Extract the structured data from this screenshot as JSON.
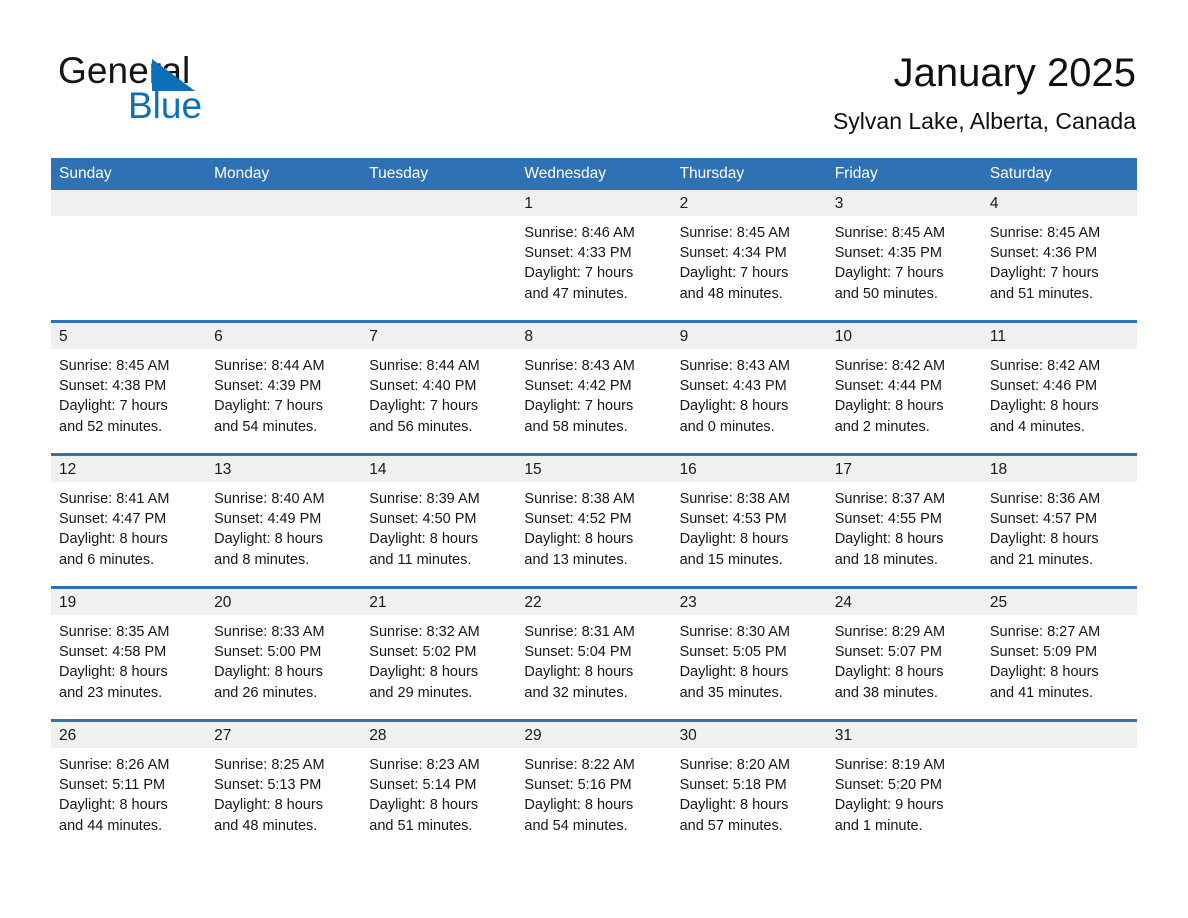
{
  "brand": {
    "name_part1": "General",
    "name_part2": "Blue",
    "triangle_color": "#0d6fb8"
  },
  "header": {
    "title": "January 2025",
    "subtitle": "Sylvan Lake, Alberta, Canada"
  },
  "theme": {
    "accent": "#2e71b5",
    "day_band": "#f0f0f0",
    "text": "#161616"
  },
  "calendar": {
    "weekday_headers": [
      "Sunday",
      "Monday",
      "Tuesday",
      "Wednesday",
      "Thursday",
      "Friday",
      "Saturday"
    ],
    "weeks": [
      [
        {
          "day": "",
          "sunrise": "",
          "sunset": "",
          "daylight_line1": "",
          "daylight_line2": ""
        },
        {
          "day": "",
          "sunrise": "",
          "sunset": "",
          "daylight_line1": "",
          "daylight_line2": ""
        },
        {
          "day": "",
          "sunrise": "",
          "sunset": "",
          "daylight_line1": "",
          "daylight_line2": ""
        },
        {
          "day": "1",
          "sunrise": "Sunrise: 8:46 AM",
          "sunset": "Sunset: 4:33 PM",
          "daylight_line1": "Daylight: 7 hours",
          "daylight_line2": "and 47 minutes."
        },
        {
          "day": "2",
          "sunrise": "Sunrise: 8:45 AM",
          "sunset": "Sunset: 4:34 PM",
          "daylight_line1": "Daylight: 7 hours",
          "daylight_line2": "and 48 minutes."
        },
        {
          "day": "3",
          "sunrise": "Sunrise: 8:45 AM",
          "sunset": "Sunset: 4:35 PM",
          "daylight_line1": "Daylight: 7 hours",
          "daylight_line2": "and 50 minutes."
        },
        {
          "day": "4",
          "sunrise": "Sunrise: 8:45 AM",
          "sunset": "Sunset: 4:36 PM",
          "daylight_line1": "Daylight: 7 hours",
          "daylight_line2": "and 51 minutes."
        }
      ],
      [
        {
          "day": "5",
          "sunrise": "Sunrise: 8:45 AM",
          "sunset": "Sunset: 4:38 PM",
          "daylight_line1": "Daylight: 7 hours",
          "daylight_line2": "and 52 minutes."
        },
        {
          "day": "6",
          "sunrise": "Sunrise: 8:44 AM",
          "sunset": "Sunset: 4:39 PM",
          "daylight_line1": "Daylight: 7 hours",
          "daylight_line2": "and 54 minutes."
        },
        {
          "day": "7",
          "sunrise": "Sunrise: 8:44 AM",
          "sunset": "Sunset: 4:40 PM",
          "daylight_line1": "Daylight: 7 hours",
          "daylight_line2": "and 56 minutes."
        },
        {
          "day": "8",
          "sunrise": "Sunrise: 8:43 AM",
          "sunset": "Sunset: 4:42 PM",
          "daylight_line1": "Daylight: 7 hours",
          "daylight_line2": "and 58 minutes."
        },
        {
          "day": "9",
          "sunrise": "Sunrise: 8:43 AM",
          "sunset": "Sunset: 4:43 PM",
          "daylight_line1": "Daylight: 8 hours",
          "daylight_line2": "and 0 minutes."
        },
        {
          "day": "10",
          "sunrise": "Sunrise: 8:42 AM",
          "sunset": "Sunset: 4:44 PM",
          "daylight_line1": "Daylight: 8 hours",
          "daylight_line2": "and 2 minutes."
        },
        {
          "day": "11",
          "sunrise": "Sunrise: 8:42 AM",
          "sunset": "Sunset: 4:46 PM",
          "daylight_line1": "Daylight: 8 hours",
          "daylight_line2": "and 4 minutes."
        }
      ],
      [
        {
          "day": "12",
          "sunrise": "Sunrise: 8:41 AM",
          "sunset": "Sunset: 4:47 PM",
          "daylight_line1": "Daylight: 8 hours",
          "daylight_line2": "and 6 minutes."
        },
        {
          "day": "13",
          "sunrise": "Sunrise: 8:40 AM",
          "sunset": "Sunset: 4:49 PM",
          "daylight_line1": "Daylight: 8 hours",
          "daylight_line2": "and 8 minutes."
        },
        {
          "day": "14",
          "sunrise": "Sunrise: 8:39 AM",
          "sunset": "Sunset: 4:50 PM",
          "daylight_line1": "Daylight: 8 hours",
          "daylight_line2": "and 11 minutes."
        },
        {
          "day": "15",
          "sunrise": "Sunrise: 8:38 AM",
          "sunset": "Sunset: 4:52 PM",
          "daylight_line1": "Daylight: 8 hours",
          "daylight_line2": "and 13 minutes."
        },
        {
          "day": "16",
          "sunrise": "Sunrise: 8:38 AM",
          "sunset": "Sunset: 4:53 PM",
          "daylight_line1": "Daylight: 8 hours",
          "daylight_line2": "and 15 minutes."
        },
        {
          "day": "17",
          "sunrise": "Sunrise: 8:37 AM",
          "sunset": "Sunset: 4:55 PM",
          "daylight_line1": "Daylight: 8 hours",
          "daylight_line2": "and 18 minutes."
        },
        {
          "day": "18",
          "sunrise": "Sunrise: 8:36 AM",
          "sunset": "Sunset: 4:57 PM",
          "daylight_line1": "Daylight: 8 hours",
          "daylight_line2": "and 21 minutes."
        }
      ],
      [
        {
          "day": "19",
          "sunrise": "Sunrise: 8:35 AM",
          "sunset": "Sunset: 4:58 PM",
          "daylight_line1": "Daylight: 8 hours",
          "daylight_line2": "and 23 minutes."
        },
        {
          "day": "20",
          "sunrise": "Sunrise: 8:33 AM",
          "sunset": "Sunset: 5:00 PM",
          "daylight_line1": "Daylight: 8 hours",
          "daylight_line2": "and 26 minutes."
        },
        {
          "day": "21",
          "sunrise": "Sunrise: 8:32 AM",
          "sunset": "Sunset: 5:02 PM",
          "daylight_line1": "Daylight: 8 hours",
          "daylight_line2": "and 29 minutes."
        },
        {
          "day": "22",
          "sunrise": "Sunrise: 8:31 AM",
          "sunset": "Sunset: 5:04 PM",
          "daylight_line1": "Daylight: 8 hours",
          "daylight_line2": "and 32 minutes."
        },
        {
          "day": "23",
          "sunrise": "Sunrise: 8:30 AM",
          "sunset": "Sunset: 5:05 PM",
          "daylight_line1": "Daylight: 8 hours",
          "daylight_line2": "and 35 minutes."
        },
        {
          "day": "24",
          "sunrise": "Sunrise: 8:29 AM",
          "sunset": "Sunset: 5:07 PM",
          "daylight_line1": "Daylight: 8 hours",
          "daylight_line2": "and 38 minutes."
        },
        {
          "day": "25",
          "sunrise": "Sunrise: 8:27 AM",
          "sunset": "Sunset: 5:09 PM",
          "daylight_line1": "Daylight: 8 hours",
          "daylight_line2": "and 41 minutes."
        }
      ],
      [
        {
          "day": "26",
          "sunrise": "Sunrise: 8:26 AM",
          "sunset": "Sunset: 5:11 PM",
          "daylight_line1": "Daylight: 8 hours",
          "daylight_line2": "and 44 minutes."
        },
        {
          "day": "27",
          "sunrise": "Sunrise: 8:25 AM",
          "sunset": "Sunset: 5:13 PM",
          "daylight_line1": "Daylight: 8 hours",
          "daylight_line2": "and 48 minutes."
        },
        {
          "day": "28",
          "sunrise": "Sunrise: 8:23 AM",
          "sunset": "Sunset: 5:14 PM",
          "daylight_line1": "Daylight: 8 hours",
          "daylight_line2": "and 51 minutes."
        },
        {
          "day": "29",
          "sunrise": "Sunrise: 8:22 AM",
          "sunset": "Sunset: 5:16 PM",
          "daylight_line1": "Daylight: 8 hours",
          "daylight_line2": "and 54 minutes."
        },
        {
          "day": "30",
          "sunrise": "Sunrise: 8:20 AM",
          "sunset": "Sunset: 5:18 PM",
          "daylight_line1": "Daylight: 8 hours",
          "daylight_line2": "and 57 minutes."
        },
        {
          "day": "31",
          "sunrise": "Sunrise: 8:19 AM",
          "sunset": "Sunset: 5:20 PM",
          "daylight_line1": "Daylight: 9 hours",
          "daylight_line2": "and 1 minute."
        },
        {
          "day": "",
          "sunrise": "",
          "sunset": "",
          "daylight_line1": "",
          "daylight_line2": ""
        }
      ]
    ]
  }
}
